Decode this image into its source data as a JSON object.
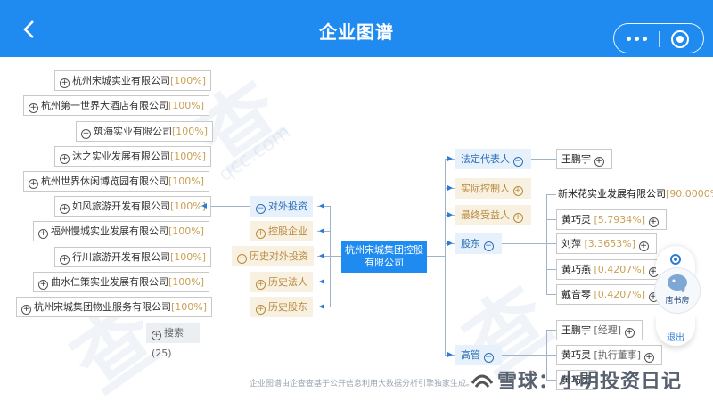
{
  "header": {
    "title": "企业图谱"
  },
  "watermark": {
    "text": "查",
    "small_text": "qcc.com"
  },
  "left_companies": [
    {
      "name": "杭州宋城实业有限公司",
      "pct": "[100%]"
    },
    {
      "name": "杭州第一世界大酒店有限公司",
      "pct": "[100%]"
    },
    {
      "name": "筑海实业有限公司",
      "pct": "[100%]"
    },
    {
      "name": "沐之实业发展有限公司",
      "pct": "[100%]"
    },
    {
      "name": "杭州世界休闲博览园有限公司",
      "pct": "[100%]"
    },
    {
      "name": "如风旅游开发有限公司",
      "pct": "[100%]"
    },
    {
      "name": "福州慢城实业发展有限公司",
      "pct": "[100%]"
    },
    {
      "name": "行川旅游开发有限公司",
      "pct": "[100%]"
    },
    {
      "name": "曲水仁策实业发展有限公司",
      "pct": "[100%]"
    },
    {
      "name": "杭州宋城集团物业服务有限公司",
      "pct": "[100%]"
    }
  ],
  "search": {
    "label": "搜索(25)"
  },
  "categories": [
    {
      "label": "对外投资",
      "sign": "⊖"
    },
    {
      "label": "控股企业",
      "sign": "⊕"
    },
    {
      "label": "历史对外投资",
      "sign": "⊕"
    },
    {
      "label": "历史法人",
      "sign": "⊕"
    },
    {
      "label": "历史股东",
      "sign": "⊕"
    }
  ],
  "center": {
    "name": "杭州宋城集团控股有限公司"
  },
  "right_labels": [
    {
      "label": "法定代表人",
      "sign": "⊖"
    },
    {
      "label": "实际控制人",
      "sign": "⊕"
    },
    {
      "label": "最终受益人",
      "sign": "⊕"
    },
    {
      "label": "股东",
      "sign": "⊖"
    },
    {
      "label": "高管",
      "sign": "⊖"
    }
  ],
  "legal_rep": {
    "name": "王鹏宇"
  },
  "shareholders": [
    {
      "name": "新米花实业发展有限公司",
      "pct": "[90.0000%]"
    },
    {
      "name": "黄巧灵",
      "pct": "[5.7934%]"
    },
    {
      "name": "刘萍",
      "pct": "[3.3653%]"
    },
    {
      "name": "黄巧燕",
      "pct": "[0.4207%]"
    },
    {
      "name": "戴音琴",
      "pct": "[0.4207%]"
    }
  ],
  "executives": [
    {
      "name": "王鹏宇",
      "role": "[经理]"
    },
    {
      "name": "黄巧灵",
      "role": "[执行董事]"
    },
    {
      "name": "黄巧灵",
      "role": ""
    }
  ],
  "float": {
    "logo_label": "唐书房",
    "exit_label": "退出"
  },
  "footer": {
    "text": "企业图谱由企查查基于公开信息利用大数据分析引擎独家生成。"
  },
  "branding": {
    "text": "雪球：小明投资日记"
  },
  "colors": {
    "header": "#1f8bf0",
    "accent_blue": "#2d6fb8",
    "pct_gold": "#c9a055"
  }
}
